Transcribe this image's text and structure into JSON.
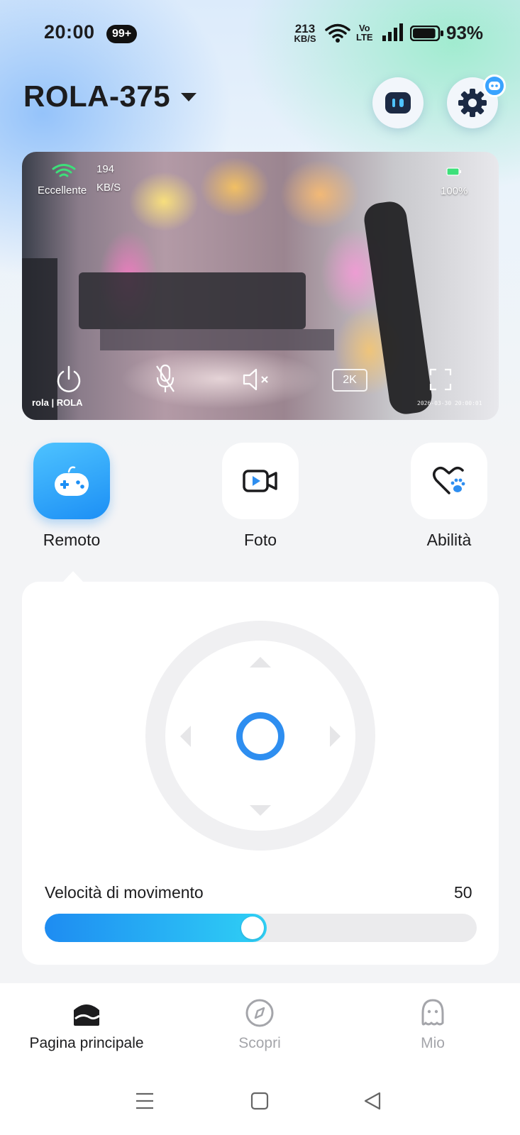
{
  "status_bar": {
    "time": "20:00",
    "notification_badge": "99+",
    "net_speed_value": "213",
    "net_speed_unit": "KB/S",
    "volte_top": "Vo",
    "volte_bottom": "LTE",
    "battery_percent": "93%",
    "battery_level": 0.93
  },
  "header": {
    "device_name": "ROLA-375",
    "robot_icon": "robot-face-icon",
    "settings_icon": "gear-icon"
  },
  "video": {
    "wifi_quality": "Eccellente",
    "bitrate_value": "194",
    "bitrate_unit": "KB/S",
    "battery_percent": "100%",
    "resolution": "2K",
    "brand": "rola | ROLA",
    "timestamp": "2026-03-30 20:00:01"
  },
  "modes": [
    {
      "label": "Remoto",
      "icon": "gamepad-icon",
      "active": true
    },
    {
      "label": "Foto",
      "icon": "video-camera-icon",
      "active": false
    },
    {
      "label": "Abilità",
      "icon": "heart-paw-icon",
      "active": false
    }
  ],
  "control": {
    "speed_label": "Velocità di movimento",
    "speed_value": "50",
    "speed_fraction": 0.5
  },
  "bottom_nav": [
    {
      "label": "Pagina principale",
      "icon": "home-icon",
      "active": true
    },
    {
      "label": "Scopri",
      "icon": "compass-icon",
      "active": false
    },
    {
      "label": "Mio",
      "icon": "profile-icon",
      "active": false
    }
  ],
  "colors": {
    "accent": "#2e8ef0",
    "active_mode": "#1c8ff5"
  }
}
